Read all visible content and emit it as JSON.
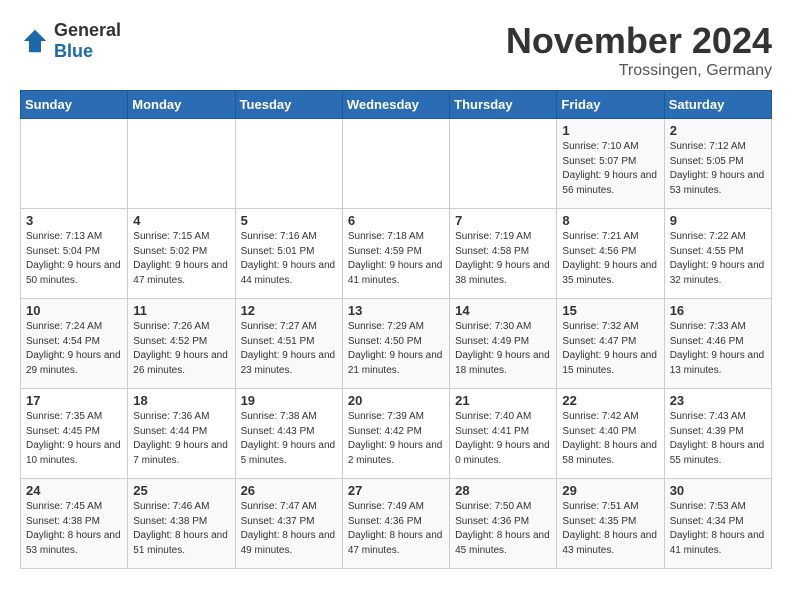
{
  "header": {
    "logo_general": "General",
    "logo_blue": "Blue",
    "month_title": "November 2024",
    "location": "Trossingen, Germany"
  },
  "days_of_week": [
    "Sunday",
    "Monday",
    "Tuesday",
    "Wednesday",
    "Thursday",
    "Friday",
    "Saturday"
  ],
  "weeks": [
    [
      {
        "day": "",
        "info": ""
      },
      {
        "day": "",
        "info": ""
      },
      {
        "day": "",
        "info": ""
      },
      {
        "day": "",
        "info": ""
      },
      {
        "day": "",
        "info": ""
      },
      {
        "day": "1",
        "info": "Sunrise: 7:10 AM\nSunset: 5:07 PM\nDaylight: 9 hours and 56 minutes."
      },
      {
        "day": "2",
        "info": "Sunrise: 7:12 AM\nSunset: 5:05 PM\nDaylight: 9 hours and 53 minutes."
      }
    ],
    [
      {
        "day": "3",
        "info": "Sunrise: 7:13 AM\nSunset: 5:04 PM\nDaylight: 9 hours and 50 minutes."
      },
      {
        "day": "4",
        "info": "Sunrise: 7:15 AM\nSunset: 5:02 PM\nDaylight: 9 hours and 47 minutes."
      },
      {
        "day": "5",
        "info": "Sunrise: 7:16 AM\nSunset: 5:01 PM\nDaylight: 9 hours and 44 minutes."
      },
      {
        "day": "6",
        "info": "Sunrise: 7:18 AM\nSunset: 4:59 PM\nDaylight: 9 hours and 41 minutes."
      },
      {
        "day": "7",
        "info": "Sunrise: 7:19 AM\nSunset: 4:58 PM\nDaylight: 9 hours and 38 minutes."
      },
      {
        "day": "8",
        "info": "Sunrise: 7:21 AM\nSunset: 4:56 PM\nDaylight: 9 hours and 35 minutes."
      },
      {
        "day": "9",
        "info": "Sunrise: 7:22 AM\nSunset: 4:55 PM\nDaylight: 9 hours and 32 minutes."
      }
    ],
    [
      {
        "day": "10",
        "info": "Sunrise: 7:24 AM\nSunset: 4:54 PM\nDaylight: 9 hours and 29 minutes."
      },
      {
        "day": "11",
        "info": "Sunrise: 7:26 AM\nSunset: 4:52 PM\nDaylight: 9 hours and 26 minutes."
      },
      {
        "day": "12",
        "info": "Sunrise: 7:27 AM\nSunset: 4:51 PM\nDaylight: 9 hours and 23 minutes."
      },
      {
        "day": "13",
        "info": "Sunrise: 7:29 AM\nSunset: 4:50 PM\nDaylight: 9 hours and 21 minutes."
      },
      {
        "day": "14",
        "info": "Sunrise: 7:30 AM\nSunset: 4:49 PM\nDaylight: 9 hours and 18 minutes."
      },
      {
        "day": "15",
        "info": "Sunrise: 7:32 AM\nSunset: 4:47 PM\nDaylight: 9 hours and 15 minutes."
      },
      {
        "day": "16",
        "info": "Sunrise: 7:33 AM\nSunset: 4:46 PM\nDaylight: 9 hours and 13 minutes."
      }
    ],
    [
      {
        "day": "17",
        "info": "Sunrise: 7:35 AM\nSunset: 4:45 PM\nDaylight: 9 hours and 10 minutes."
      },
      {
        "day": "18",
        "info": "Sunrise: 7:36 AM\nSunset: 4:44 PM\nDaylight: 9 hours and 7 minutes."
      },
      {
        "day": "19",
        "info": "Sunrise: 7:38 AM\nSunset: 4:43 PM\nDaylight: 9 hours and 5 minutes."
      },
      {
        "day": "20",
        "info": "Sunrise: 7:39 AM\nSunset: 4:42 PM\nDaylight: 9 hours and 2 minutes."
      },
      {
        "day": "21",
        "info": "Sunrise: 7:40 AM\nSunset: 4:41 PM\nDaylight: 9 hours and 0 minutes."
      },
      {
        "day": "22",
        "info": "Sunrise: 7:42 AM\nSunset: 4:40 PM\nDaylight: 8 hours and 58 minutes."
      },
      {
        "day": "23",
        "info": "Sunrise: 7:43 AM\nSunset: 4:39 PM\nDaylight: 8 hours and 55 minutes."
      }
    ],
    [
      {
        "day": "24",
        "info": "Sunrise: 7:45 AM\nSunset: 4:38 PM\nDaylight: 8 hours and 53 minutes."
      },
      {
        "day": "25",
        "info": "Sunrise: 7:46 AM\nSunset: 4:38 PM\nDaylight: 8 hours and 51 minutes."
      },
      {
        "day": "26",
        "info": "Sunrise: 7:47 AM\nSunset: 4:37 PM\nDaylight: 8 hours and 49 minutes."
      },
      {
        "day": "27",
        "info": "Sunrise: 7:49 AM\nSunset: 4:36 PM\nDaylight: 8 hours and 47 minutes."
      },
      {
        "day": "28",
        "info": "Sunrise: 7:50 AM\nSunset: 4:36 PM\nDaylight: 8 hours and 45 minutes."
      },
      {
        "day": "29",
        "info": "Sunrise: 7:51 AM\nSunset: 4:35 PM\nDaylight: 8 hours and 43 minutes."
      },
      {
        "day": "30",
        "info": "Sunrise: 7:53 AM\nSunset: 4:34 PM\nDaylight: 8 hours and 41 minutes."
      }
    ]
  ]
}
